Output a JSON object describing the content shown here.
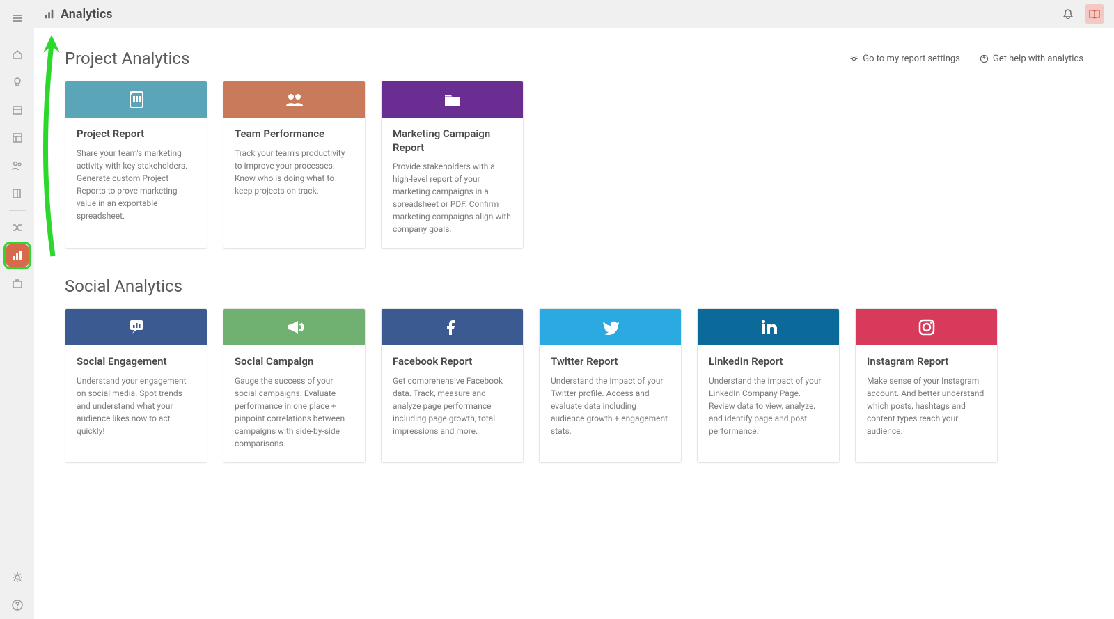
{
  "page": {
    "title": "Analytics"
  },
  "header_links": {
    "settings": "Go to my report settings",
    "help": "Get help with analytics"
  },
  "sections": [
    {
      "title": "Project Analytics",
      "show_links": true,
      "cards": [
        {
          "id": "project-report",
          "color": "#5aa5b7",
          "icon": "report",
          "title": "Project Report",
          "desc": "Share your team's marketing activity with key stakeholders. Generate custom Project Reports to prove marketing value in an exportable spreadsheet."
        },
        {
          "id": "team-performance",
          "color": "#c97a5a",
          "icon": "team",
          "title": "Team Performance",
          "desc": "Track your team's productivity to improve your processes. Know who is doing what to keep projects on track."
        },
        {
          "id": "marketing-campaign",
          "color": "#6a2d91",
          "icon": "folder",
          "title": "Marketing Campaign Report",
          "desc": "Provide stakeholders with a high-level report of your marketing campaigns in a spreadsheet or PDF. Confirm marketing campaigns align with company goals."
        }
      ]
    },
    {
      "title": "Social Analytics",
      "show_links": false,
      "cards": [
        {
          "id": "social-engagement",
          "color": "#3a5a91",
          "icon": "engagement",
          "title": "Social Engagement",
          "desc": "Understand your engagement on social media. Spot trends and understand what your audience likes now to act quickly!"
        },
        {
          "id": "social-campaign",
          "color": "#70b171",
          "icon": "megaphone",
          "title": "Social Campaign",
          "desc": "Gauge the success of your social campaigns. Evaluate performance in one place + pinpoint correlations between campaigns with side-by-side comparisons."
        },
        {
          "id": "facebook-report",
          "color": "#3a5a91",
          "icon": "facebook",
          "title": "Facebook Report",
          "desc": "Get comprehensive Facebook data. Track, measure and analyze page performance including page growth, total impressions and more."
        },
        {
          "id": "twitter-report",
          "color": "#2ba9e1",
          "icon": "twitter",
          "title": "Twitter Report",
          "desc": "Understand the impact of your Twitter profile. Access and evaluate data including audience growth + engagement stats."
        },
        {
          "id": "linkedin-report",
          "color": "#0b6a9a",
          "icon": "linkedin",
          "title": "LinkedIn Report",
          "desc": "Understand the impact of your LinkedIn Company Page. Review data to view, analyze, and identify page and post performance."
        },
        {
          "id": "instagram-report",
          "color": "#d83a5c",
          "icon": "instagram",
          "title": "Instagram Report",
          "desc": "Make sense of your Instagram account. And better understand which posts, hashtags and content types reach your audience."
        }
      ]
    }
  ]
}
